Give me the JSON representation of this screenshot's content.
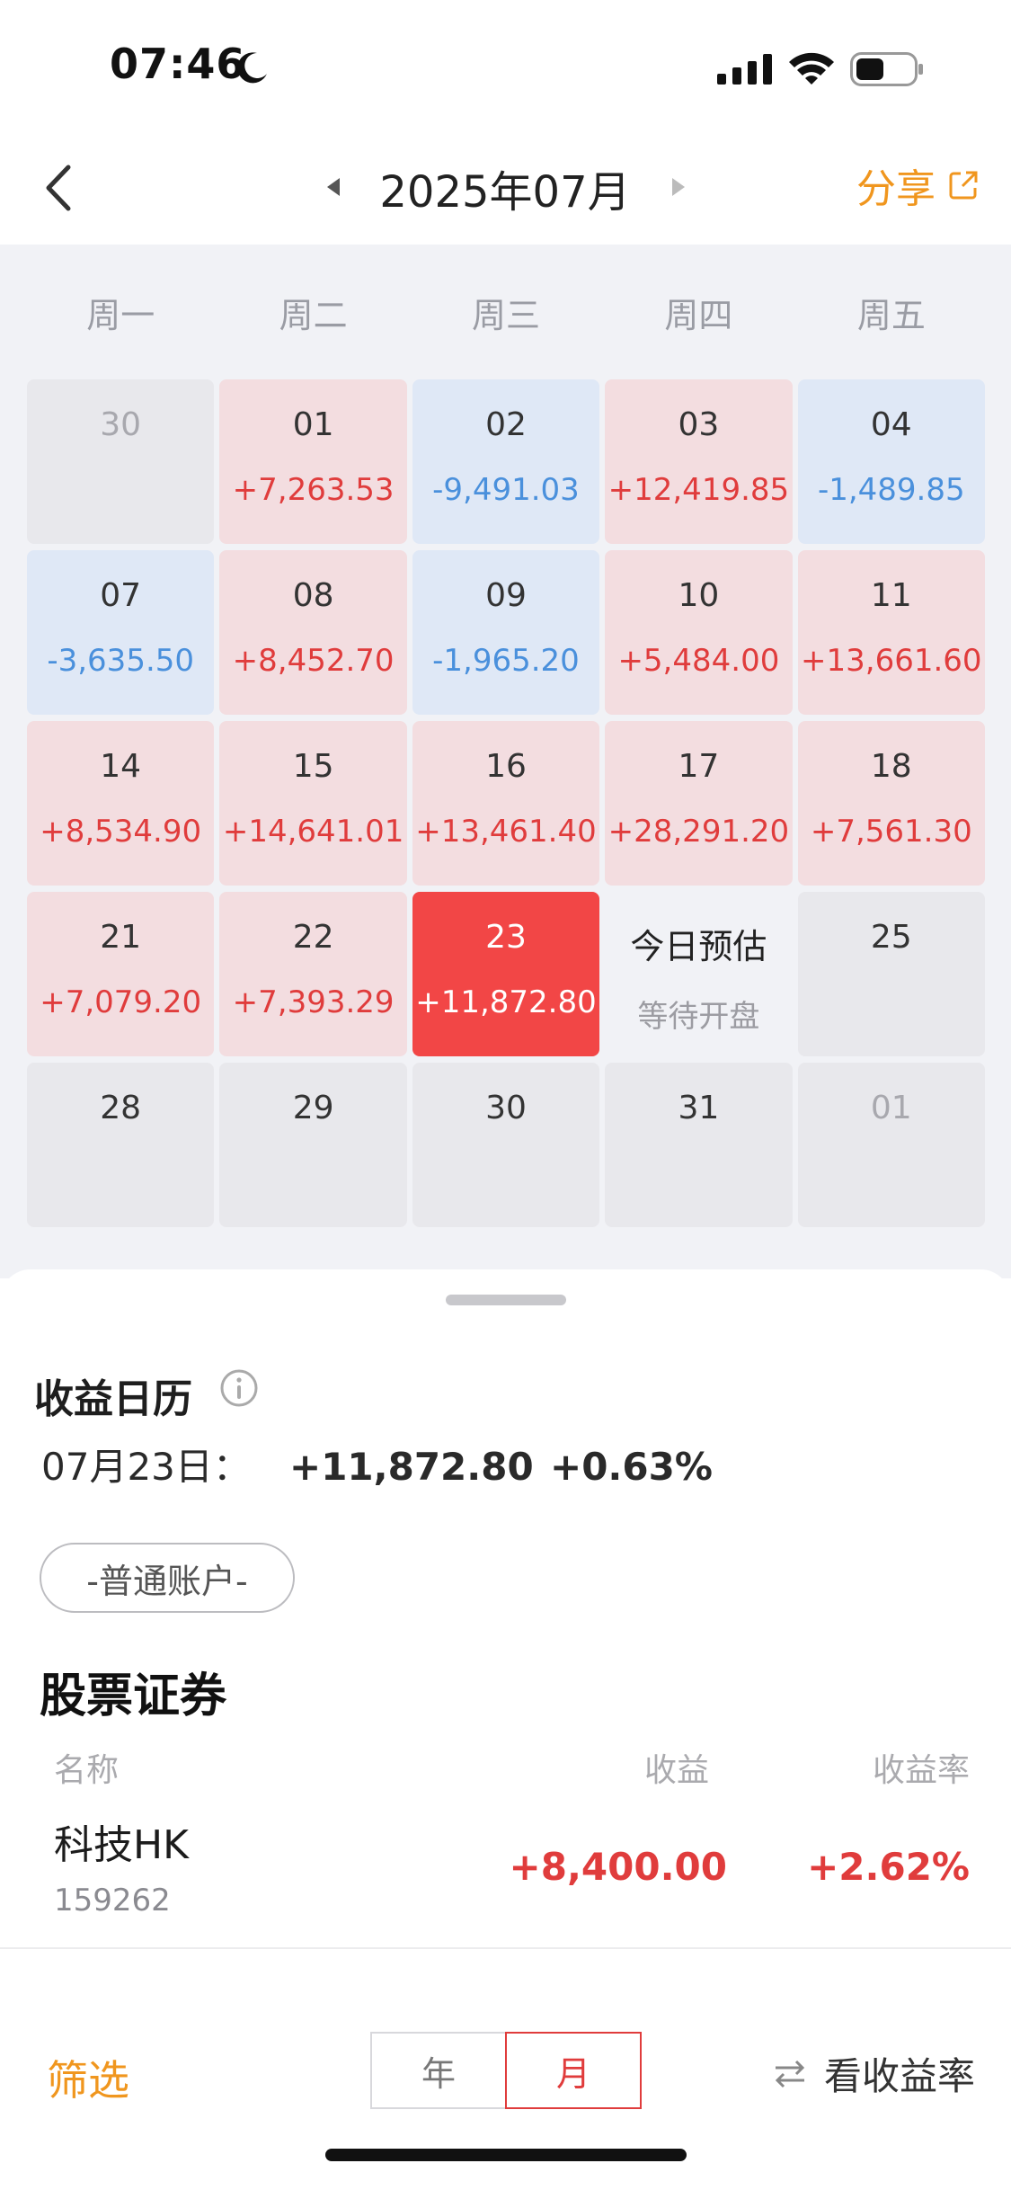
{
  "status": {
    "time": "07:46"
  },
  "nav": {
    "title": "2025年07月",
    "share_label": "分享"
  },
  "weekdays": [
    "周一",
    "周二",
    "周三",
    "周四",
    "周五"
  ],
  "calendar": [
    {
      "day": "30",
      "value": "",
      "kind": "gray",
      "dim": true
    },
    {
      "day": "01",
      "value": "+7,263.53",
      "kind": "red"
    },
    {
      "day": "02",
      "value": "-9,491.03",
      "kind": "blue"
    },
    {
      "day": "03",
      "value": "+12,419.85",
      "kind": "red"
    },
    {
      "day": "04",
      "value": "-1,489.85",
      "kind": "blue"
    },
    {
      "day": "07",
      "value": "-3,635.50",
      "kind": "blue"
    },
    {
      "day": "08",
      "value": "+8,452.70",
      "kind": "red"
    },
    {
      "day": "09",
      "value": "-1,965.20",
      "kind": "blue"
    },
    {
      "day": "10",
      "value": "+5,484.00",
      "kind": "red"
    },
    {
      "day": "11",
      "value": "+13,661.60",
      "kind": "red"
    },
    {
      "day": "14",
      "value": "+8,534.90",
      "kind": "red"
    },
    {
      "day": "15",
      "value": "+14,641.01",
      "kind": "red"
    },
    {
      "day": "16",
      "value": "+13,461.40",
      "kind": "red"
    },
    {
      "day": "17",
      "value": "+28,291.20",
      "kind": "red"
    },
    {
      "day": "18",
      "value": "+7,561.30",
      "kind": "red"
    },
    {
      "day": "21",
      "value": "+7,079.20",
      "kind": "red"
    },
    {
      "day": "22",
      "value": "+7,393.29",
      "kind": "red"
    },
    {
      "day": "23",
      "value": "+11,872.80",
      "kind": "active"
    },
    {
      "day": "今日预估",
      "value": "等待开盘",
      "kind": "today"
    },
    {
      "day": "25",
      "value": "",
      "kind": "gray"
    },
    {
      "day": "28",
      "value": "",
      "kind": "gray"
    },
    {
      "day": "29",
      "value": "",
      "kind": "gray"
    },
    {
      "day": "30",
      "value": "",
      "kind": "gray"
    },
    {
      "day": "31",
      "value": "",
      "kind": "gray"
    },
    {
      "day": "01",
      "value": "",
      "kind": "gray",
      "dim": true
    }
  ],
  "summary": {
    "title": "收益日历",
    "date": "07月23日：",
    "amount": "+11,872.80",
    "pct": "+0.63%"
  },
  "account": {
    "label": "-普通账户-"
  },
  "stocks": {
    "title": "股票证券",
    "headers": {
      "name": "名称",
      "profit": "收益",
      "rate": "收益率"
    },
    "rows": [
      {
        "name": "科技HK",
        "code": "159262",
        "profit": "+8,400.00",
        "rate": "+2.62%"
      }
    ]
  },
  "toolbar": {
    "filter_label": "筛选",
    "year_label": "年",
    "month_label": "月",
    "rate_label": "看收益率"
  },
  "colors": {
    "accent": "#f0961e",
    "gain": "#e03c3c",
    "loss": "#4a90dc",
    "active_day": "#f24646"
  }
}
